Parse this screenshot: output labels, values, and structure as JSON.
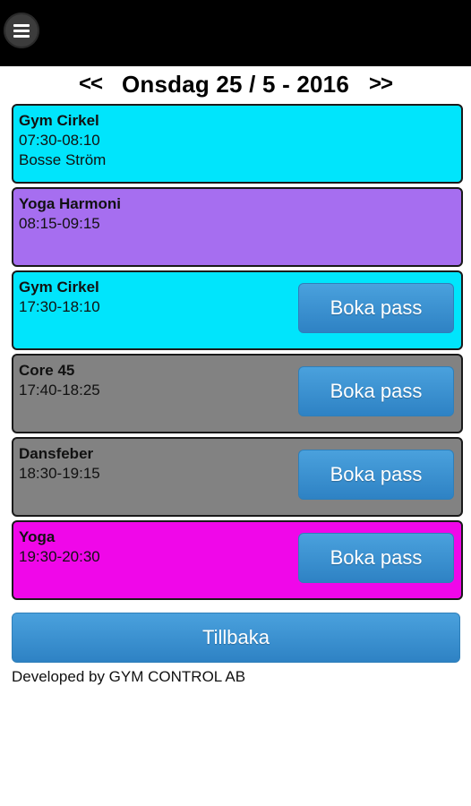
{
  "header": {
    "menu_icon": "hamburger-menu-icon"
  },
  "date_nav": {
    "prev": "<<",
    "date": "Onsdag 25 / 5 - 2016",
    "next": ">>"
  },
  "sessions": [
    {
      "title": "Gym Cirkel",
      "time": "07:30-08:10",
      "instructor": "Bosse Ström",
      "color": "#00e5fc",
      "book_label": null
    },
    {
      "title": "Yoga Harmoni",
      "time": "08:15-09:15",
      "instructor": null,
      "color": "#a66ef0",
      "book_label": null
    },
    {
      "title": "Gym Cirkel",
      "time": "17:30-18:10",
      "instructor": null,
      "color": "#00e5fc",
      "book_label": "Boka pass"
    },
    {
      "title": "Core 45",
      "time": "17:40-18:25",
      "instructor": null,
      "color": "#828282",
      "book_label": "Boka pass"
    },
    {
      "title": "Dansfeber",
      "time": "18:30-19:15",
      "instructor": null,
      "color": "#828282",
      "book_label": "Boka pass"
    },
    {
      "title": "Yoga",
      "time": "19:30-20:30",
      "instructor": null,
      "color": "#f007e9",
      "book_label": "Boka pass"
    }
  ],
  "back_button": "Tillbaka",
  "footer": "Developed by GYM CONTROL AB",
  "colors": {
    "topbar": "#000000",
    "button": "#3a8fd2"
  }
}
